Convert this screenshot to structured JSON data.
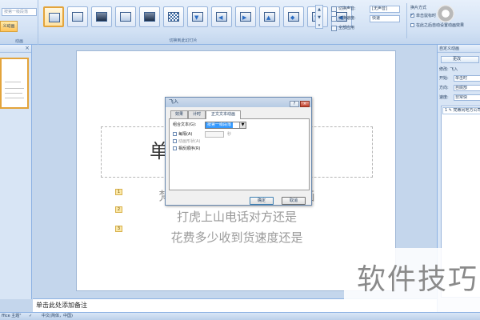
{
  "ribbon": {
    "anim_combo_value": "按第一级段落",
    "anim_button_label": "义动画",
    "group_animation": "动画",
    "group_transition": "切换到此幻灯片",
    "sound_label": "切换声音:",
    "sound_value": "[无声音]",
    "speed_label": "切换速度:",
    "speed_value": "快速",
    "apply_all_label": "全部应用",
    "advance_title": "换片方式",
    "advance_on_click": "单击鼠标时",
    "advance_after": "在此之后自动设置动画效果"
  },
  "slides_panel": {
    "close_glyph": "×"
  },
  "slide": {
    "title_char": "单",
    "bullet_1": "梵蒂冈地方公司电视台上地画",
    "bullet_2": "打虎上山电话对方还是",
    "bullet_3": "花费多少收到货速度还是",
    "tags": [
      "1",
      "2",
      "3"
    ]
  },
  "notes_placeholder": "单击此处添加备注",
  "custom_pane": {
    "title": "自定义动画",
    "change_button": "更改",
    "modify_label": "修改: 飞入",
    "start_label": "开始:",
    "start_value": "单击时",
    "direction_label": "方向:",
    "direction_value": "自底部",
    "speed_label": "速度:",
    "speed_value": "非常快",
    "list_item": "1 ✎ 梵蒂冈地方公司"
  },
  "status": {
    "theme": "ffice 主题\"",
    "language": "中文(简体，中国)"
  },
  "dialog": {
    "title": "飞入",
    "help": "?",
    "close": "×",
    "tabs": [
      "效果",
      "计时",
      "正文文本动画"
    ],
    "group_text_label": "组合文本(G):",
    "group_text_value": "按第一级段落",
    "every_label": "每隔(A)",
    "every_value": "",
    "seconds_unit": "秒",
    "attached_shape_label": "动画形状(A)",
    "reverse_label": "相反顺序(R)",
    "ok_label": "确定",
    "cancel_label": "取消"
  },
  "watermark": {
    "text": "软件技巧"
  },
  "colors": {
    "ribbon": "#d2e1f4",
    "accent": "#e3a43b",
    "dialog_select": "#3399ff"
  }
}
